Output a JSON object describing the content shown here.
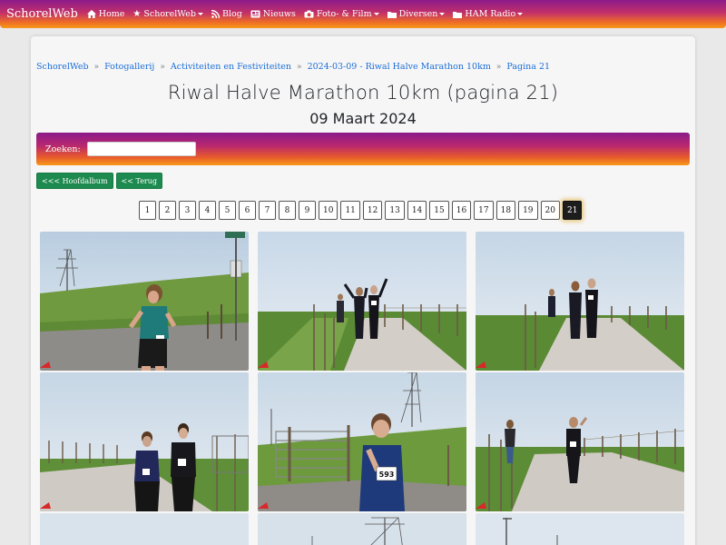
{
  "navbar": {
    "brand": "SchorelWeb",
    "items": [
      {
        "label": "Home",
        "icon": "home-icon",
        "dropdown": false
      },
      {
        "label": "SchorelWeb",
        "icon": "star-icon",
        "dropdown": true
      },
      {
        "label": "Blog",
        "icon": "rss-icon",
        "dropdown": false
      },
      {
        "label": "Nieuws",
        "icon": "newspaper-icon",
        "dropdown": false
      },
      {
        "label": "Foto- & Film",
        "icon": "camera-icon",
        "dropdown": true
      },
      {
        "label": "Diversen",
        "icon": "folder-icon",
        "dropdown": true
      },
      {
        "label": "HAM Radio",
        "icon": "folder-icon",
        "dropdown": true
      }
    ]
  },
  "breadcrumb": [
    "SchorelWeb",
    "Fotogallerij",
    "Activiteiten en Festiviteiten",
    "2024-03-09 - Riwal Halve Marathon 10km",
    "Pagina 21"
  ],
  "page": {
    "title": "Riwal Halve Marathon 10km (pagina 21)",
    "subtitle": "09 Maart 2024"
  },
  "search": {
    "label": "Zoeken:",
    "value": ""
  },
  "buttons": {
    "main_album": "<<< Hoofdalbum",
    "back": "<< Terug"
  },
  "pagination": {
    "pages": [
      "1",
      "2",
      "3",
      "4",
      "5",
      "6",
      "7",
      "8",
      "9",
      "10",
      "11",
      "12",
      "13",
      "14",
      "15",
      "16",
      "17",
      "18",
      "19",
      "20",
      "21"
    ],
    "active": "21"
  },
  "photos": [
    {
      "bib": "",
      "scene": "runner-woman-teal-top-dyke"
    },
    {
      "bib": "",
      "scene": "two-runners-arms-raised-path"
    },
    {
      "bib": "",
      "scene": "two-runners-path"
    },
    {
      "bib": "",
      "scene": "two-runners-side-by-side"
    },
    {
      "bib": "593",
      "scene": "runner-woman-blue-jacket-gate"
    },
    {
      "bib": "",
      "scene": "runner-woman-path-fence"
    }
  ],
  "colors": {
    "accent_gradient": [
      "#8a1a8a",
      "#f79a1a"
    ],
    "button_green": "#1d8a4f",
    "link_blue": "#1a6fd6"
  }
}
